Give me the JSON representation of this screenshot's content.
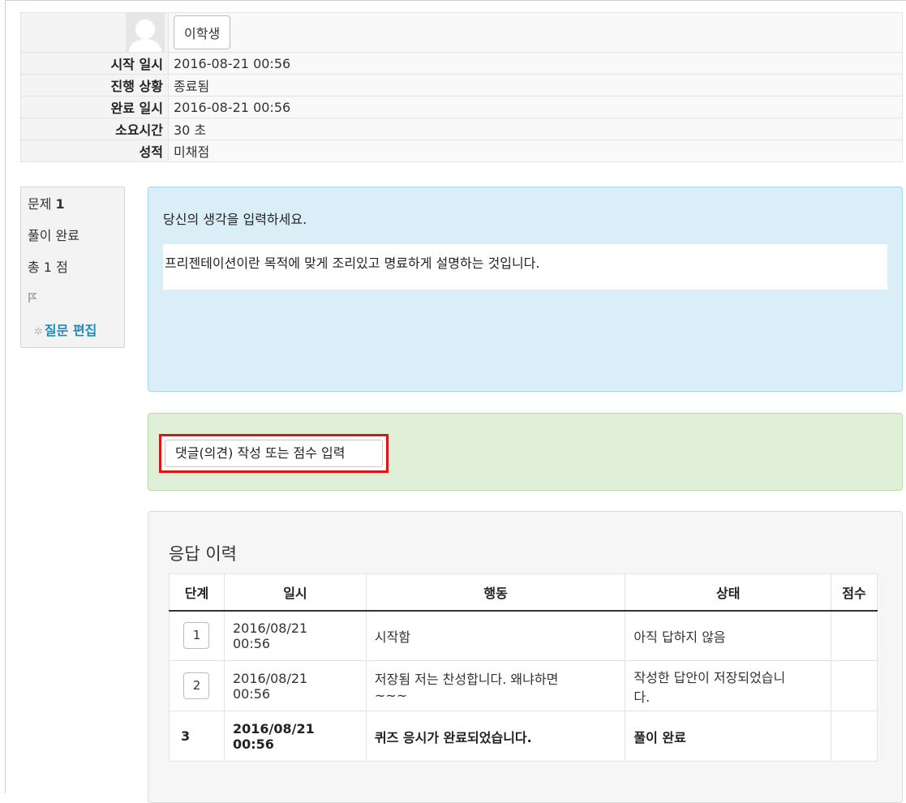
{
  "summary": {
    "user_button": "이학생",
    "rows": [
      {
        "label": "시작 일시",
        "value": "2016-08-21 00:56"
      },
      {
        "label": "진행 상황",
        "value": "종료됨"
      },
      {
        "label": "완료 일시",
        "value": "2016-08-21 00:56"
      },
      {
        "label": "소요시간",
        "value": "30 초"
      },
      {
        "label": "성적",
        "value": "미채점"
      }
    ]
  },
  "question_info": {
    "label": "문제",
    "number": "1",
    "state": "풀이 완료",
    "mark": "총 1 점",
    "flag_icon": "flag-icon",
    "edit_link": "질문 편집"
  },
  "question": {
    "prompt": "당신의 생각을 입력하세요.",
    "answer": "프리젠테이션이란 목적에 맞게 조리있고 명료하게 설명하는 것입니다."
  },
  "comment": {
    "button_label": "댓글(의견) 작성 또는 점수 입력",
    "highlight_color": "#e01414"
  },
  "history": {
    "title": "응답 이력",
    "headers": [
      "단계",
      "일시",
      "행동",
      "상태",
      "점수"
    ],
    "rows": [
      {
        "step": "1",
        "time_date": "2016/08/21",
        "time_clock": "00:56",
        "action": "시작함",
        "action2": "",
        "state": "아직 답하지 않음",
        "state2": "",
        "score": ""
      },
      {
        "step": "2",
        "time_date": "2016/08/21",
        "time_clock": "00:56",
        "action": "저장됨 저는 찬성합니다. 왜냐하면",
        "action2": "~~~",
        "state": "작성한 답안이 저장되었습니",
        "state2": "다.",
        "score": ""
      },
      {
        "step": "3",
        "time_date": "2016/08/21",
        "time_clock": "00:56",
        "action": "퀴즈 응시가 완료되었습니다.",
        "action2": "",
        "state": "풀이 완료",
        "state2": "",
        "score": ""
      }
    ]
  }
}
